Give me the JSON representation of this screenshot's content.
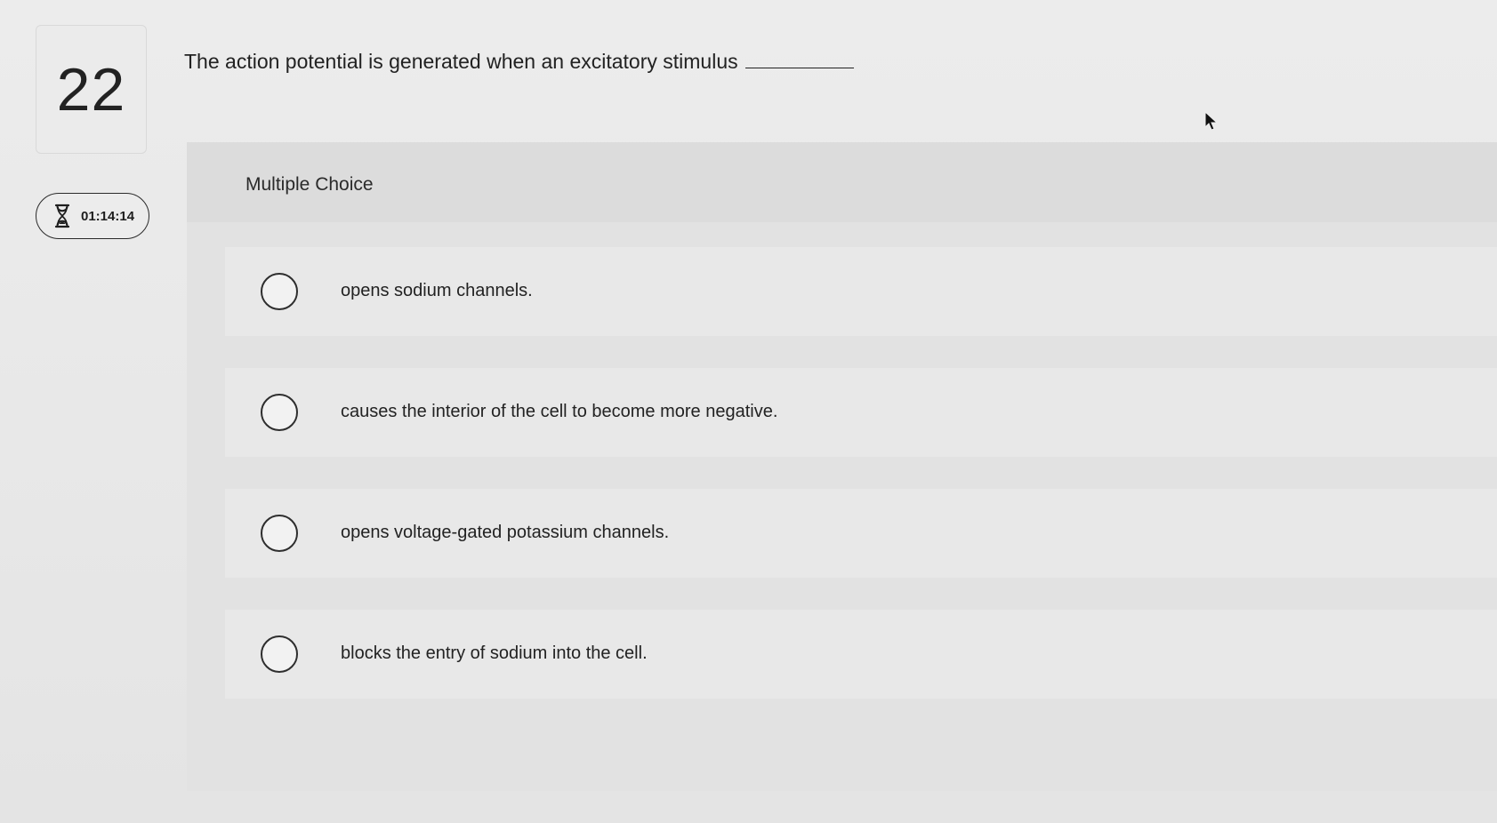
{
  "question": {
    "number": "22",
    "text": "The action potential is generated when an excitatory stimulus"
  },
  "timer": {
    "icon": "hourglass-icon",
    "value": "01:14:14"
  },
  "answer_panel": {
    "type_label": "Multiple Choice",
    "options": [
      {
        "label": "opens sodium channels.",
        "selected": false
      },
      {
        "label": "causes the interior of the cell to become more negative.",
        "selected": false
      },
      {
        "label": "opens voltage-gated potassium channels.",
        "selected": false
      },
      {
        "label": "blocks the entry of sodium into the cell.",
        "selected": false
      }
    ]
  },
  "colors": {
    "background": "#e9e9e9",
    "panel": "#e2e2e2",
    "option_background": "#e8e8e8",
    "text": "#222222"
  }
}
